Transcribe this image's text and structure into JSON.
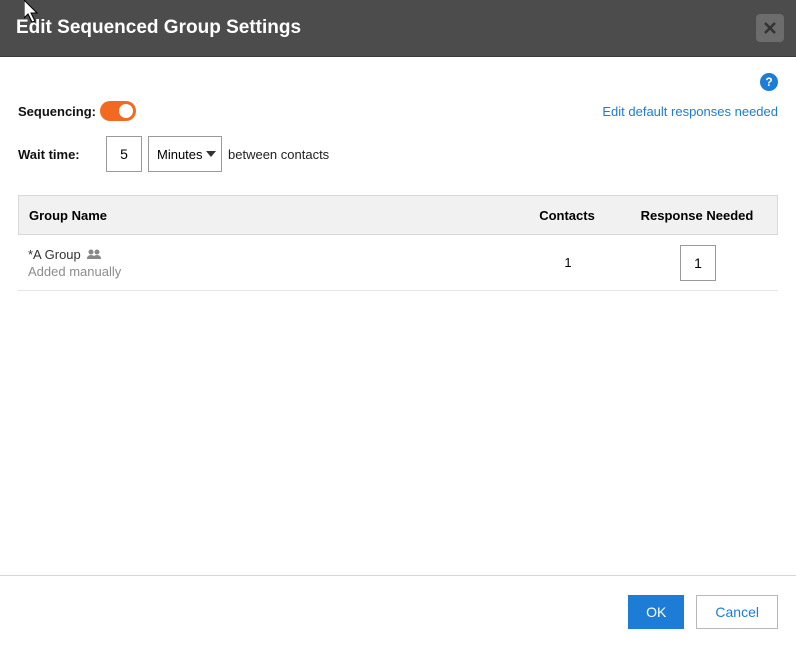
{
  "header": {
    "title": "Edit Sequenced Group Settings"
  },
  "links": {
    "edit_defaults": "Edit default responses needed"
  },
  "labels": {
    "sequencing": "Sequencing:",
    "wait_time": "Wait time:",
    "between": "between contacts"
  },
  "inputs": {
    "wait_value": "5",
    "unit_selected": "Minutes"
  },
  "table": {
    "head": {
      "name": "Group Name",
      "contacts": "Contacts",
      "resp": "Response Needed"
    },
    "rows": [
      {
        "name": "*A Group",
        "sub": "Added manually",
        "contacts": "1",
        "resp": "1"
      }
    ]
  },
  "footer": {
    "ok": "OK",
    "cancel": "Cancel"
  }
}
